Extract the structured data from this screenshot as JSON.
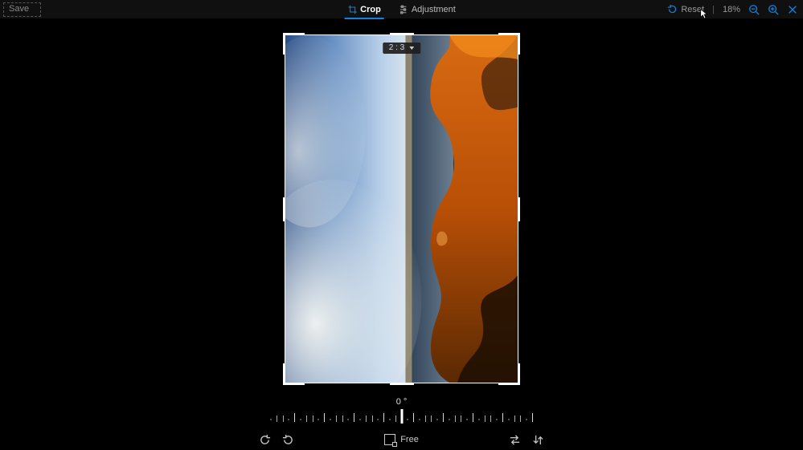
{
  "toolbar": {
    "save_label": "Save",
    "tabs": {
      "crop": {
        "label": "Crop",
        "active": true
      },
      "adjustment": {
        "label": "Adjustment",
        "active": false
      }
    },
    "reset_label": "Reset",
    "zoom_level": "18%"
  },
  "crop": {
    "ratio_label": "2 : 3",
    "angle_label": "0 °",
    "aspect_mode": "Free"
  },
  "colors": {
    "accent": "#0f82e6"
  }
}
